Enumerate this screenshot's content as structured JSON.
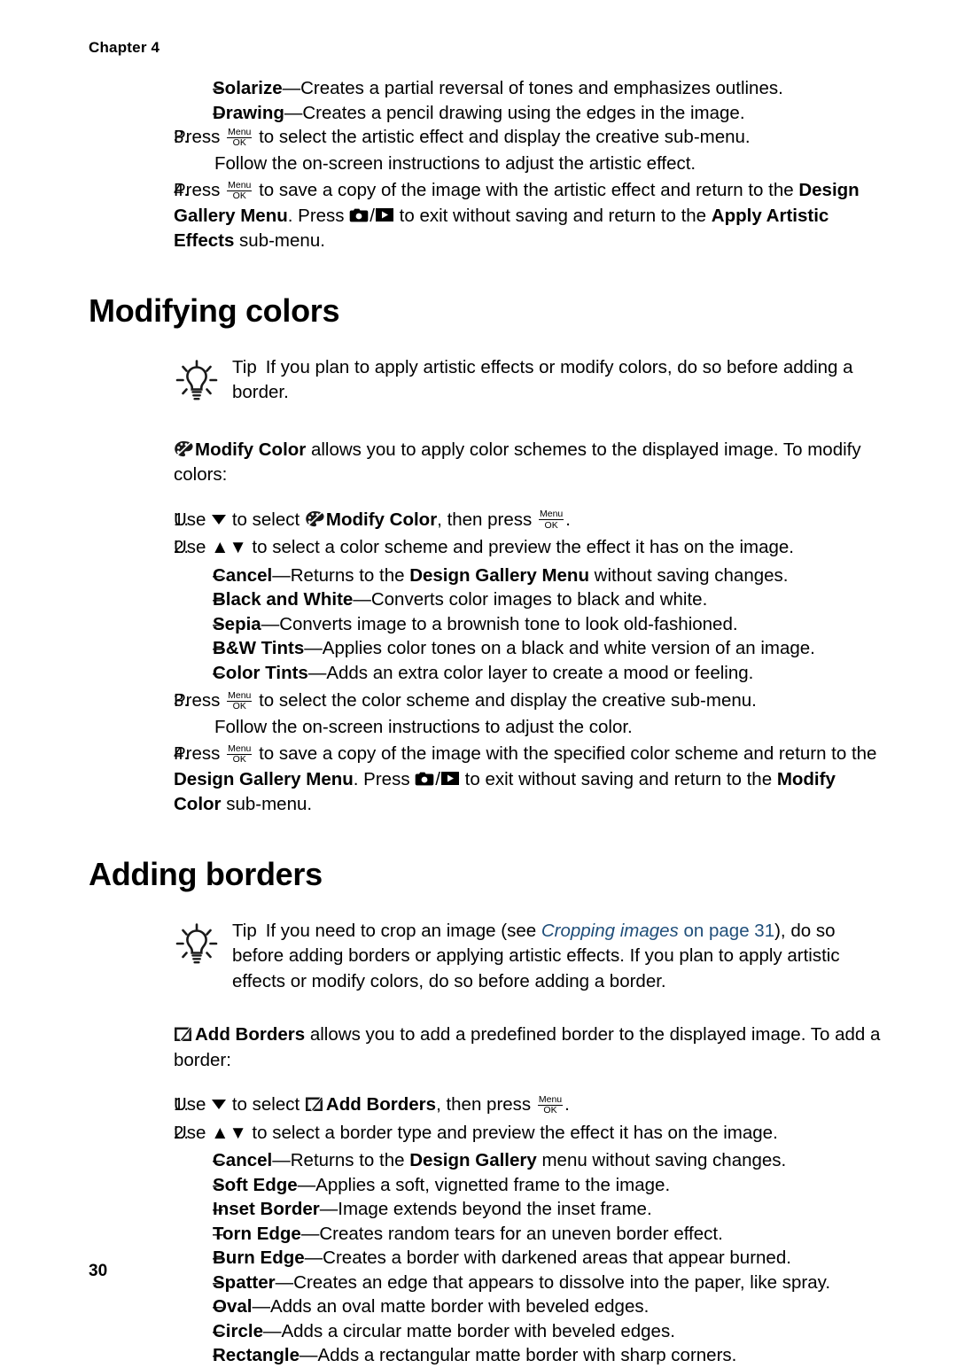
{
  "header": {
    "chapter": "Chapter 4"
  },
  "footer": {
    "page_number": "30"
  },
  "icons": {
    "menu_ok_top": "Menu",
    "menu_ok_bottom": "OK",
    "camera": "camera-icon",
    "playback": "playback-icon",
    "lightbulb": "lightbulb-tip-icon",
    "modify_color": "palette-icon",
    "add_borders": "border-frame-icon",
    "arrow_down": "arrow-down-icon",
    "arrow_up": "arrow-up-icon"
  },
  "colors": {
    "text": "#000000",
    "link": "#1F4E79",
    "background": "#FFFFFF"
  },
  "artistic_effects": {
    "bullets": [
      {
        "term": "Solarize",
        "desc": "—Creates a partial reversal of tones and emphasizes outlines."
      },
      {
        "term": "Drawing",
        "desc": "—Creates a pencil drawing using the edges in the image."
      }
    ],
    "step3": {
      "num": "3.",
      "part1": "Press ",
      "part2": " to select the artistic effect and display the creative sub-menu.",
      "line2": "Follow the on-screen instructions to adjust the artistic effect."
    },
    "step4": {
      "num": "4.",
      "part1": "Press ",
      "part2": " to save a copy of the image with the artistic effect and return to the ",
      "bold1": "Design Gallery Menu",
      "part3": ". Press ",
      "part4": " to exit without saving and return to the ",
      "bold2": "Apply Artistic Effects",
      "part5": " sub-menu."
    }
  },
  "modifying_colors": {
    "heading": "Modifying colors",
    "tip": {
      "label": "Tip",
      "text": "If you plan to apply artistic effects or modify colors, do so before adding a border."
    },
    "intro": {
      "bold": "Modify Color",
      "text": " allows you to apply color schemes to the displayed image. To modify colors:"
    },
    "step1": {
      "num": "1.",
      "part1": "Use ",
      "part2": " to select ",
      "bold": "Modify Color",
      "part3": ", then press ",
      "part4": "."
    },
    "step2": {
      "num": "2.",
      "text": "Use ▲▼ to select a color scheme and preview the effect it has on the image."
    },
    "bullets": [
      {
        "term": "Cancel",
        "desc_before": "—Returns to the ",
        "bold": "Design Gallery Menu",
        "desc_after": " without saving changes."
      },
      {
        "term": "Black and White",
        "desc_before": "—Converts color images to black and white.",
        "bold": "",
        "desc_after": ""
      },
      {
        "term": "Sepia",
        "desc_before": "—Converts image to a brownish tone to look old-fashioned.",
        "bold": "",
        "desc_after": ""
      },
      {
        "term": "B&W Tints",
        "desc_before": "—Applies color tones on a black and white version of an image.",
        "bold": "",
        "desc_after": ""
      },
      {
        "term": "Color Tints",
        "desc_before": "—Adds an extra color layer to create a mood or feeling.",
        "bold": "",
        "desc_after": ""
      }
    ],
    "step3": {
      "num": "3.",
      "part1": "Press ",
      "part2": " to select the color scheme and display the creative sub-menu.",
      "line2": "Follow the on-screen instructions to adjust the color."
    },
    "step4": {
      "num": "4.",
      "part1": "Press ",
      "part2": " to save a copy of the image with the specified color scheme and return to the ",
      "bold1": "Design Gallery Menu",
      "part3": ". Press ",
      "part4": " to exit without saving and return to the ",
      "bold2": "Modify Color",
      "part5": " sub-menu."
    }
  },
  "adding_borders": {
    "heading": "Adding borders",
    "tip": {
      "label": "Tip",
      "part1": "If you need to crop an image (see ",
      "link_italic": "Cropping images",
      "link_rest": " on page 31",
      "part2": "), do so before adding borders or applying artistic effects. If you plan to apply artistic effects or modify colors, do so before adding a border."
    },
    "intro": {
      "bold": "Add Borders",
      "text": " allows you to add a predefined border to the displayed image. To add a border:"
    },
    "step1": {
      "num": "1.",
      "part1": "Use ",
      "part2": " to select ",
      "bold": "Add Borders",
      "part3": ", then press ",
      "part4": "."
    },
    "step2": {
      "num": "2.",
      "text": "Use ▲▼ to select a border type and preview the effect it has on the image."
    },
    "bullets": [
      {
        "term": "Cancel",
        "desc_before": "—Returns to the ",
        "bold": "Design Gallery",
        "desc_after": " menu without saving changes."
      },
      {
        "term": "Soft Edge",
        "desc_before": "—Applies a soft, vignetted frame to the image.",
        "bold": "",
        "desc_after": ""
      },
      {
        "term": "Inset Border",
        "desc_before": "—Image extends beyond the inset frame.",
        "bold": "",
        "desc_after": ""
      },
      {
        "term": "Torn Edge",
        "desc_before": "—Creates random tears for an uneven border effect.",
        "bold": "",
        "desc_after": ""
      },
      {
        "term": "Burn Edge",
        "desc_before": "—Creates a border with darkened areas that appear burned.",
        "bold": "",
        "desc_after": ""
      },
      {
        "term": "Spatter",
        "desc_before": "—Creates an edge that appears to dissolve into the paper, like spray.",
        "bold": "",
        "desc_after": ""
      },
      {
        "term": "Oval",
        "desc_before": "—Adds an oval matte border with beveled edges.",
        "bold": "",
        "desc_after": ""
      },
      {
        "term": "Circle",
        "desc_before": "—Adds a circular matte border with beveled edges.",
        "bold": "",
        "desc_after": ""
      },
      {
        "term": "Rectangle",
        "desc_before": "—Adds a rectangular matte border with sharp corners.",
        "bold": "",
        "desc_after": ""
      }
    ]
  },
  "dash": "–"
}
